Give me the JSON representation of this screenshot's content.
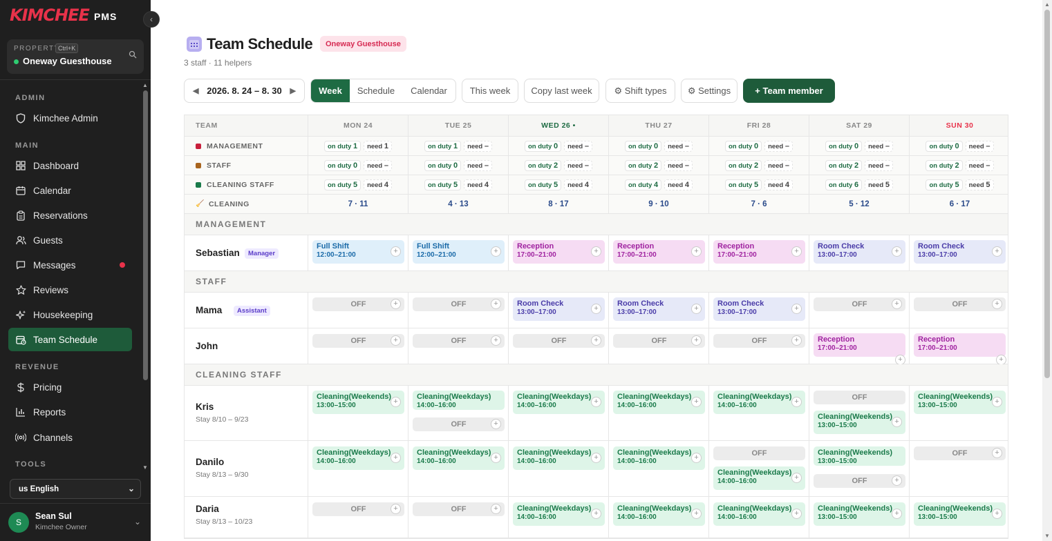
{
  "brand": {
    "logo": "KIMCHEE",
    "suffix": "PMS"
  },
  "property": {
    "label": "PROPERTY",
    "shortcut": "Ctrl+K",
    "name": "Oneway Guesthouse"
  },
  "sidebar": {
    "sections": {
      "admin": "ADMIN",
      "main": "MAIN",
      "revenue": "REVENUE",
      "tools": "TOOLS"
    },
    "items": [
      {
        "label": "Kimchee Admin",
        "icon": "shield-icon"
      },
      {
        "label": "Dashboard",
        "icon": "grid-icon"
      },
      {
        "label": "Calendar",
        "icon": "calendar-icon"
      },
      {
        "label": "Reservations",
        "icon": "clipboard-icon"
      },
      {
        "label": "Guests",
        "icon": "users-icon"
      },
      {
        "label": "Messages",
        "icon": "chat-icon"
      },
      {
        "label": "Reviews",
        "icon": "star-icon"
      },
      {
        "label": "Housekeeping",
        "icon": "sparkle-icon"
      },
      {
        "label": "Team Schedule",
        "icon": "calendar-clock-icon"
      },
      {
        "label": "Pricing",
        "icon": "dollar-icon"
      },
      {
        "label": "Reports",
        "icon": "bar-chart-icon"
      },
      {
        "label": "Channels",
        "icon": "broadcast-icon"
      }
    ],
    "language": "us English",
    "user": {
      "initial": "S",
      "name": "Sean Sul",
      "role": "Kimchee Owner"
    }
  },
  "page": {
    "title": "Team Schedule",
    "property_badge": "Oneway Guesthouse",
    "subtitle": "3 staff · 11 helpers"
  },
  "toolbar": {
    "date_range": "2026. 8. 24 – 8. 30",
    "views": [
      "Week",
      "Schedule",
      "Calendar"
    ],
    "this_week": "This week",
    "copy_last_week": "Copy last week",
    "shift_types": "⚙ Shift types",
    "settings": "⚙ Settings",
    "add_member": "+ Team member"
  },
  "grid": {
    "team_header": "TEAM",
    "days": [
      "MON 24",
      "TUE 25",
      "WED 26 •",
      "THU 27",
      "FRI 28",
      "SAT 29",
      "SUN 30"
    ],
    "summary": [
      {
        "label": "MANAGEMENT",
        "color": "#c8203c",
        "on": [
          "1",
          "1",
          "0",
          "0",
          "0",
          "0",
          "0"
        ],
        "need": [
          "1",
          "–",
          "–",
          "–",
          "–",
          "–",
          "–"
        ]
      },
      {
        "label": "STAFF",
        "color": "#a8641e",
        "on": [
          "0",
          "0",
          "2",
          "2",
          "2",
          "2",
          "2"
        ],
        "need": [
          "–",
          "–",
          "–",
          "–",
          "–",
          "–",
          "–"
        ]
      },
      {
        "label": "CLEANING STAFF",
        "color": "#1a7a4a",
        "on": [
          "5",
          "5",
          "5",
          "4",
          "5",
          "6",
          "5"
        ],
        "need": [
          "4",
          "4",
          "4",
          "4",
          "4",
          "5",
          "5"
        ]
      }
    ],
    "on_duty_label": "on duty",
    "need_label": "need",
    "cleaning": {
      "label": "CLEANING",
      "values": [
        "7 · 11",
        "4 · 13",
        "8 · 17",
        "9 · 10",
        "7 · 6",
        "5 · 12",
        "6 · 17"
      ]
    },
    "groups": {
      "management": "MANAGEMENT",
      "staff": "STAFF",
      "cleaning": "CLEANING STAFF"
    },
    "off": "OFF",
    "people": {
      "sebastian": {
        "name": "Sebastian",
        "role": "Manager"
      },
      "mama": {
        "name": "Mama",
        "role": "Assistant"
      },
      "john": {
        "name": "John"
      },
      "kris": {
        "name": "Kris",
        "stay": "Stay 8/10 – 9/23"
      },
      "danilo": {
        "name": "Danilo",
        "stay": "Stay 8/13 – 9/30"
      },
      "daria": {
        "name": "Daria",
        "stay": "Stay 8/13 – 10/23"
      }
    },
    "shifts": {
      "full": {
        "name": "Full Shift",
        "time": "12:00–21:00"
      },
      "reception": {
        "name": "Reception",
        "time": "17:00–21:00"
      },
      "room_check": {
        "name": "Room Check",
        "time": "13:00–17:00"
      },
      "clean_weekends": {
        "name": "Cleaning(Weekends)",
        "time": "13:00–15:00"
      },
      "clean_weekdays": {
        "name": "Cleaning(Weekdays)",
        "time": "14:00–16:00"
      }
    }
  },
  "colors": {
    "accent": "#1e5b3a",
    "brand": "#e8324a",
    "sidebar_bg": "#1f1f1f"
  }
}
